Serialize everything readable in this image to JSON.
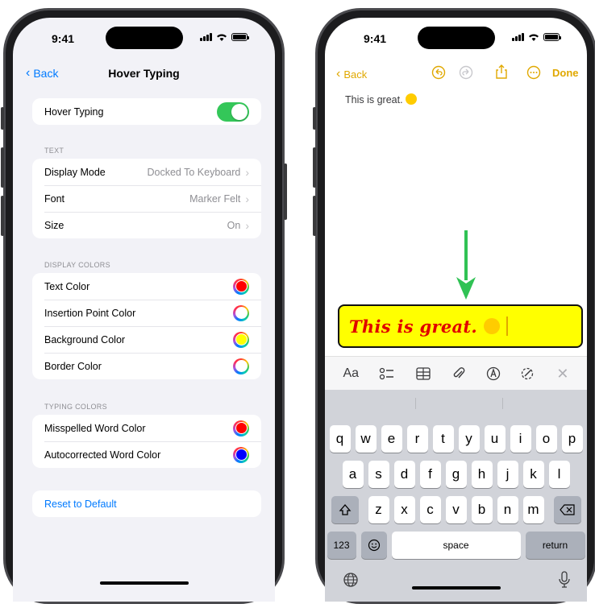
{
  "left_phone": {
    "status": {
      "time": "9:41"
    },
    "nav": {
      "back_label": "Back",
      "title": "Hover Typing"
    },
    "hover_typing": {
      "label": "Hover Typing",
      "enabled": true
    },
    "text_section": {
      "header": "TEXT",
      "rows": [
        {
          "label": "Display Mode",
          "value": "Docked To Keyboard"
        },
        {
          "label": "Font",
          "value": "Marker Felt"
        },
        {
          "label": "Size",
          "value": "On"
        }
      ]
    },
    "display_colors": {
      "header": "DISPLAY COLORS",
      "rows": [
        {
          "label": "Text Color",
          "color": "#ff0000"
        },
        {
          "label": "Insertion Point Color",
          "color": "#ffffff"
        },
        {
          "label": "Background Color",
          "color": "#ffff00"
        },
        {
          "label": "Border Color",
          "color": "#ffffff"
        }
      ]
    },
    "typing_colors": {
      "header": "TYPING COLORS",
      "rows": [
        {
          "label": "Misspelled Word Color",
          "color": "#ff0000"
        },
        {
          "label": "Autocorrected Word Color",
          "color": "#0000ff"
        }
      ]
    },
    "reset_label": "Reset to Default"
  },
  "right_phone": {
    "status": {
      "time": "9:41"
    },
    "nav": {
      "back_label": "Back",
      "done_label": "Done",
      "accent": "#e0a800"
    },
    "note_text": "This is great.",
    "hover_text": "This is great.",
    "hover_colors": {
      "text": "#e00000",
      "background": "#ffff00",
      "border": "#111111"
    },
    "format_bar": {
      "text_style_label": "Aa",
      "icons": [
        "checklist-icon",
        "table-icon",
        "paperclip-icon",
        "markup-icon",
        "writing-tools-icon",
        "close-icon"
      ]
    },
    "keyboard": {
      "row1": [
        "q",
        "w",
        "e",
        "r",
        "t",
        "y",
        "u",
        "i",
        "o",
        "p"
      ],
      "row2": [
        "a",
        "s",
        "d",
        "f",
        "g",
        "h",
        "j",
        "k",
        "l"
      ],
      "row3": [
        "z",
        "x",
        "c",
        "v",
        "b",
        "n",
        "m"
      ],
      "numbers_label": "123",
      "space_label": "space",
      "return_label": "return"
    }
  }
}
